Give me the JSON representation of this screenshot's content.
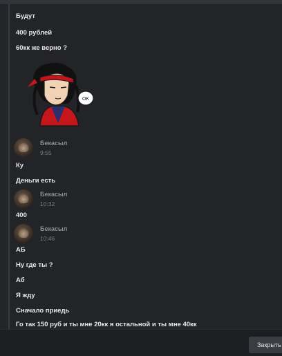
{
  "messages_top": [
    "Будут",
    "400 рублей",
    "60кк же верно ?"
  ],
  "sticker": {
    "bubble_text": "OK"
  },
  "groups": [
    {
      "author": "Бекасыл",
      "time": "9:55",
      "lines": [
        "Ку",
        "Деньги есть"
      ]
    },
    {
      "author": "Бекасыл",
      "time": "10:32",
      "lines": [
        "400"
      ]
    },
    {
      "author": "Бекасыл",
      "time": "10:46",
      "lines": [
        "АБ",
        "Ну где ты ?",
        "Аб",
        "Я жду",
        "Сначало приедь",
        "Го так 150 руб и ты мне 20кк я остальной и ты мне 40кк"
      ]
    }
  ],
  "footer": {
    "close_label": "Закрыть"
  }
}
